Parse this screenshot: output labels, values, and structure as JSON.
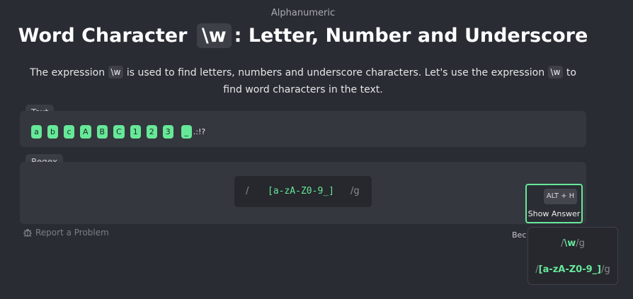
{
  "header": {
    "category": "Alphanumeric",
    "title_before": "Word Character",
    "title_code": "\\w",
    "title_after": ": Letter, Number and Underscore"
  },
  "description": {
    "part1": "The expression",
    "code1": "\\w",
    "part2": "is used to find letters, numbers and underscore characters. Let's use the expression",
    "code2": "\\w",
    "part3": "to find word characters in the text."
  },
  "text_section": {
    "label": "Text",
    "matched_chars": [
      "a",
      "b",
      "c",
      "A",
      "B",
      "C",
      "1",
      "2",
      "3",
      "_"
    ],
    "unmatched_tail": ".:!?"
  },
  "regex_section": {
    "label": "Regex",
    "slash": "/",
    "value": "[a-zA-Z0-9_]",
    "flags": "/g"
  },
  "answer_button": {
    "shortcut": "ALT + H",
    "label": "Show Answer"
  },
  "report": {
    "label": "Report a Problem"
  },
  "become_text": "Bec",
  "answers_popup": {
    "answer1": {
      "prefix": "/",
      "pattern": "\\w",
      "suffix": "/g"
    },
    "answer2": {
      "prefix": "/",
      "pattern": "[a-zA-Z0-9_]",
      "suffix": "/g"
    }
  },
  "colors": {
    "background": "#292c33",
    "accent": "#66e899",
    "panel": "#34373d"
  }
}
